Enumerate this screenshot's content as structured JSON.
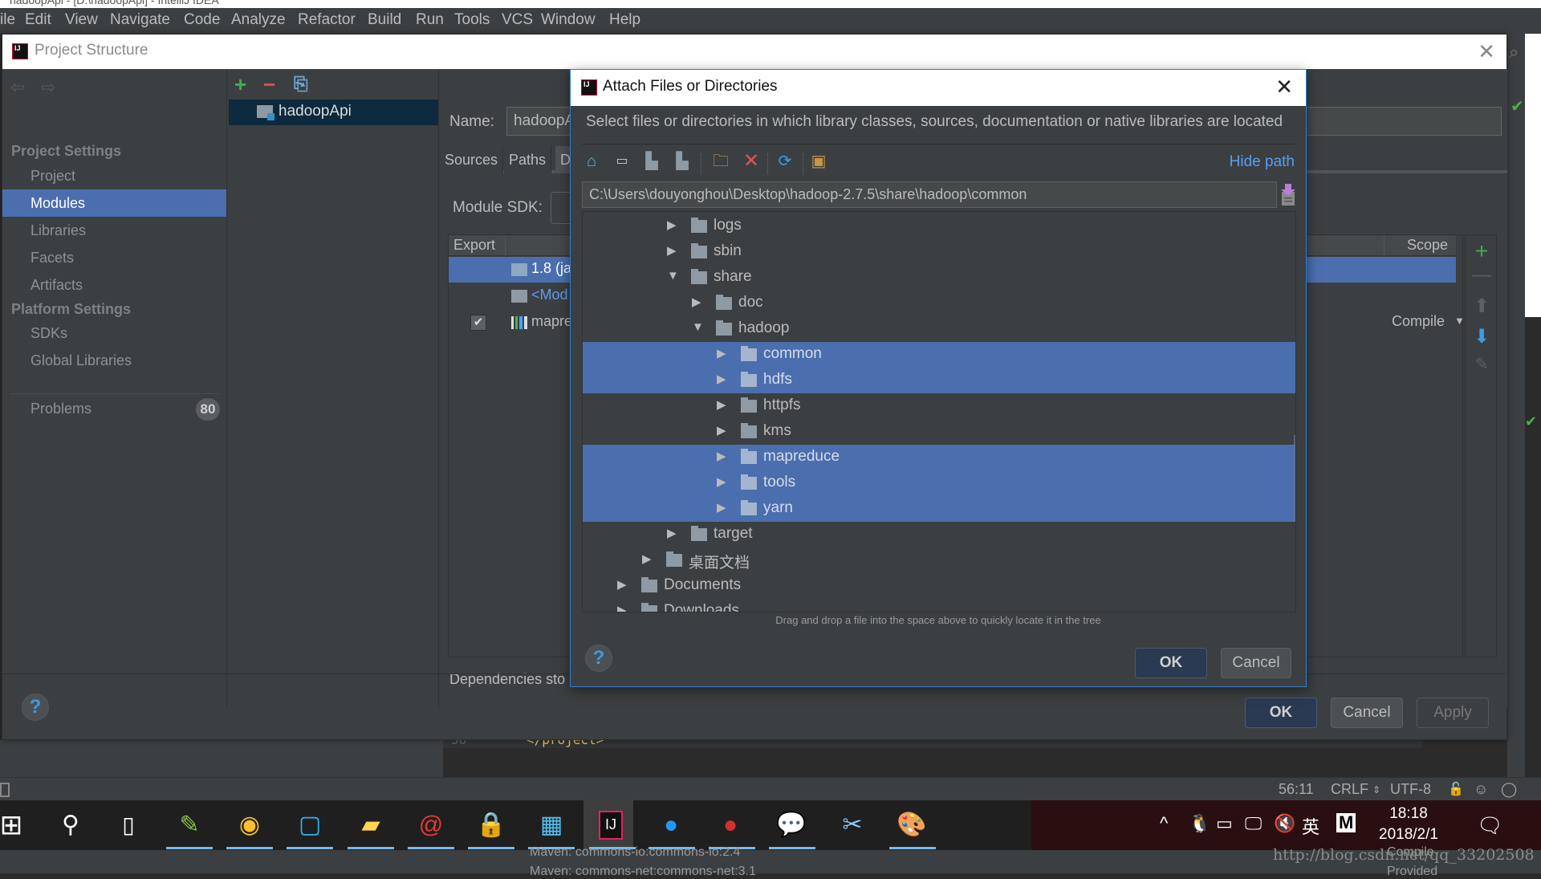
{
  "window": {
    "title": "hadoopApi - [D:\\hadoopApi] - IntelliJ IDEA"
  },
  "menubar": {
    "items": [
      "ile",
      "Edit",
      "View",
      "Navigate",
      "Code",
      "Analyze",
      "Refactor",
      "Build",
      "Run",
      "Tools",
      "VCS",
      "Window",
      "Help"
    ]
  },
  "project_structure": {
    "title": "Project Structure",
    "sidebar": {
      "project_settings_header": "Project Settings",
      "project_settings_items": [
        {
          "label": "Project",
          "selected": false
        },
        {
          "label": "Modules",
          "selected": true
        },
        {
          "label": "Libraries",
          "selected": false
        },
        {
          "label": "Facets",
          "selected": false
        },
        {
          "label": "Artifacts",
          "selected": false
        }
      ],
      "platform_settings_header": "Platform Settings",
      "platform_settings_items": [
        {
          "label": "SDKs"
        },
        {
          "label": "Global Libraries"
        }
      ],
      "problems_label": "Problems",
      "problems_count": "80"
    },
    "modules": {
      "items": [
        "hadoopApi"
      ]
    },
    "module_detail": {
      "name_label": "Name:",
      "name_value": "hadoopA",
      "tabs": [
        "Sources",
        "Paths",
        "D"
      ],
      "module_sdk_label": "Module SDK:",
      "table_headers": {
        "export": "Export",
        "scope": "Scope"
      },
      "rows": [
        {
          "label": "1.8 (ja",
          "selected": true,
          "checked": null,
          "scope": ""
        },
        {
          "label": "<Mod",
          "selected": false,
          "checked": null,
          "scope": ""
        },
        {
          "label": "mapre",
          "selected": false,
          "checked": true,
          "scope": "Compile"
        }
      ],
      "dependencies_storage_label": "Dependencies sto"
    },
    "buttons": {
      "ok": "OK",
      "cancel": "Cancel",
      "apply": "Apply",
      "help": "?"
    }
  },
  "attach_dialog": {
    "title": "Attach Files or Directories",
    "description": "Select files or directories in which library classes, sources, documentation or native libraries are located",
    "hide_path": "Hide path",
    "path": "C:\\Users\\douyonghou\\Desktop\\hadoop-2.7.5\\share\\hadoop\\common",
    "tree": [
      {
        "name": "logs",
        "depth": 3,
        "expanded": false,
        "selected": false
      },
      {
        "name": "sbin",
        "depth": 3,
        "expanded": false,
        "selected": false
      },
      {
        "name": "share",
        "depth": 3,
        "expanded": true,
        "selected": false
      },
      {
        "name": "doc",
        "depth": 4,
        "expanded": false,
        "selected": false
      },
      {
        "name": "hadoop",
        "depth": 4,
        "expanded": true,
        "selected": false
      },
      {
        "name": "common",
        "depth": 5,
        "expanded": false,
        "selected": true
      },
      {
        "name": "hdfs",
        "depth": 5,
        "expanded": false,
        "selected": true
      },
      {
        "name": "httpfs",
        "depth": 5,
        "expanded": false,
        "selected": false
      },
      {
        "name": "kms",
        "depth": 5,
        "expanded": false,
        "selected": false
      },
      {
        "name": "mapreduce",
        "depth": 5,
        "expanded": false,
        "selected": true
      },
      {
        "name": "tools",
        "depth": 5,
        "expanded": false,
        "selected": true
      },
      {
        "name": "yarn",
        "depth": 5,
        "expanded": false,
        "selected": true
      },
      {
        "name": "target",
        "depth": 3,
        "expanded": false,
        "selected": false
      },
      {
        "name": "桌面文档",
        "depth": 2,
        "expanded": false,
        "selected": false
      },
      {
        "name": "Documents",
        "depth": 1,
        "expanded": false,
        "selected": false
      },
      {
        "name": "Downloads",
        "depth": 1,
        "expanded": false,
        "selected": false
      }
    ],
    "drag_hint": "Drag and drop a file into the space above to quickly locate it in the tree",
    "buttons": {
      "ok": "OK",
      "cancel": "Cancel",
      "help": "?"
    }
  },
  "editor": {
    "line_number": "56",
    "code": "</project>"
  },
  "statusbar": {
    "position": "56:11",
    "line_separator": "CRLF",
    "encoding": "UTF-8"
  },
  "taskbar": {
    "apps": [
      "windows-start",
      "search",
      "task-view",
      "notepad",
      "chrome",
      "app-blue",
      "file-explorer",
      "snail-app",
      "lock-app",
      "control-panel",
      "intellij-idea",
      "dingtalk",
      "app-red",
      "wechat",
      "snipping-tool",
      "paint"
    ],
    "tray": {
      "ime": "英",
      "ime2": "M"
    },
    "time": "18:18",
    "date": "2018/2/1"
  },
  "background": {
    "lines": [
      "Maven: commons-io:commons-io:2.4",
      "Maven: commons-net:commons-net:3.1"
    ],
    "scope1": "Compile",
    "scope2": "Provided"
  },
  "watermark": "http://blog.csdn.net/qq_33202508",
  "colors": {
    "selection": "#4b6eaf",
    "link": "#589df6",
    "panel": "#3c3f41"
  }
}
